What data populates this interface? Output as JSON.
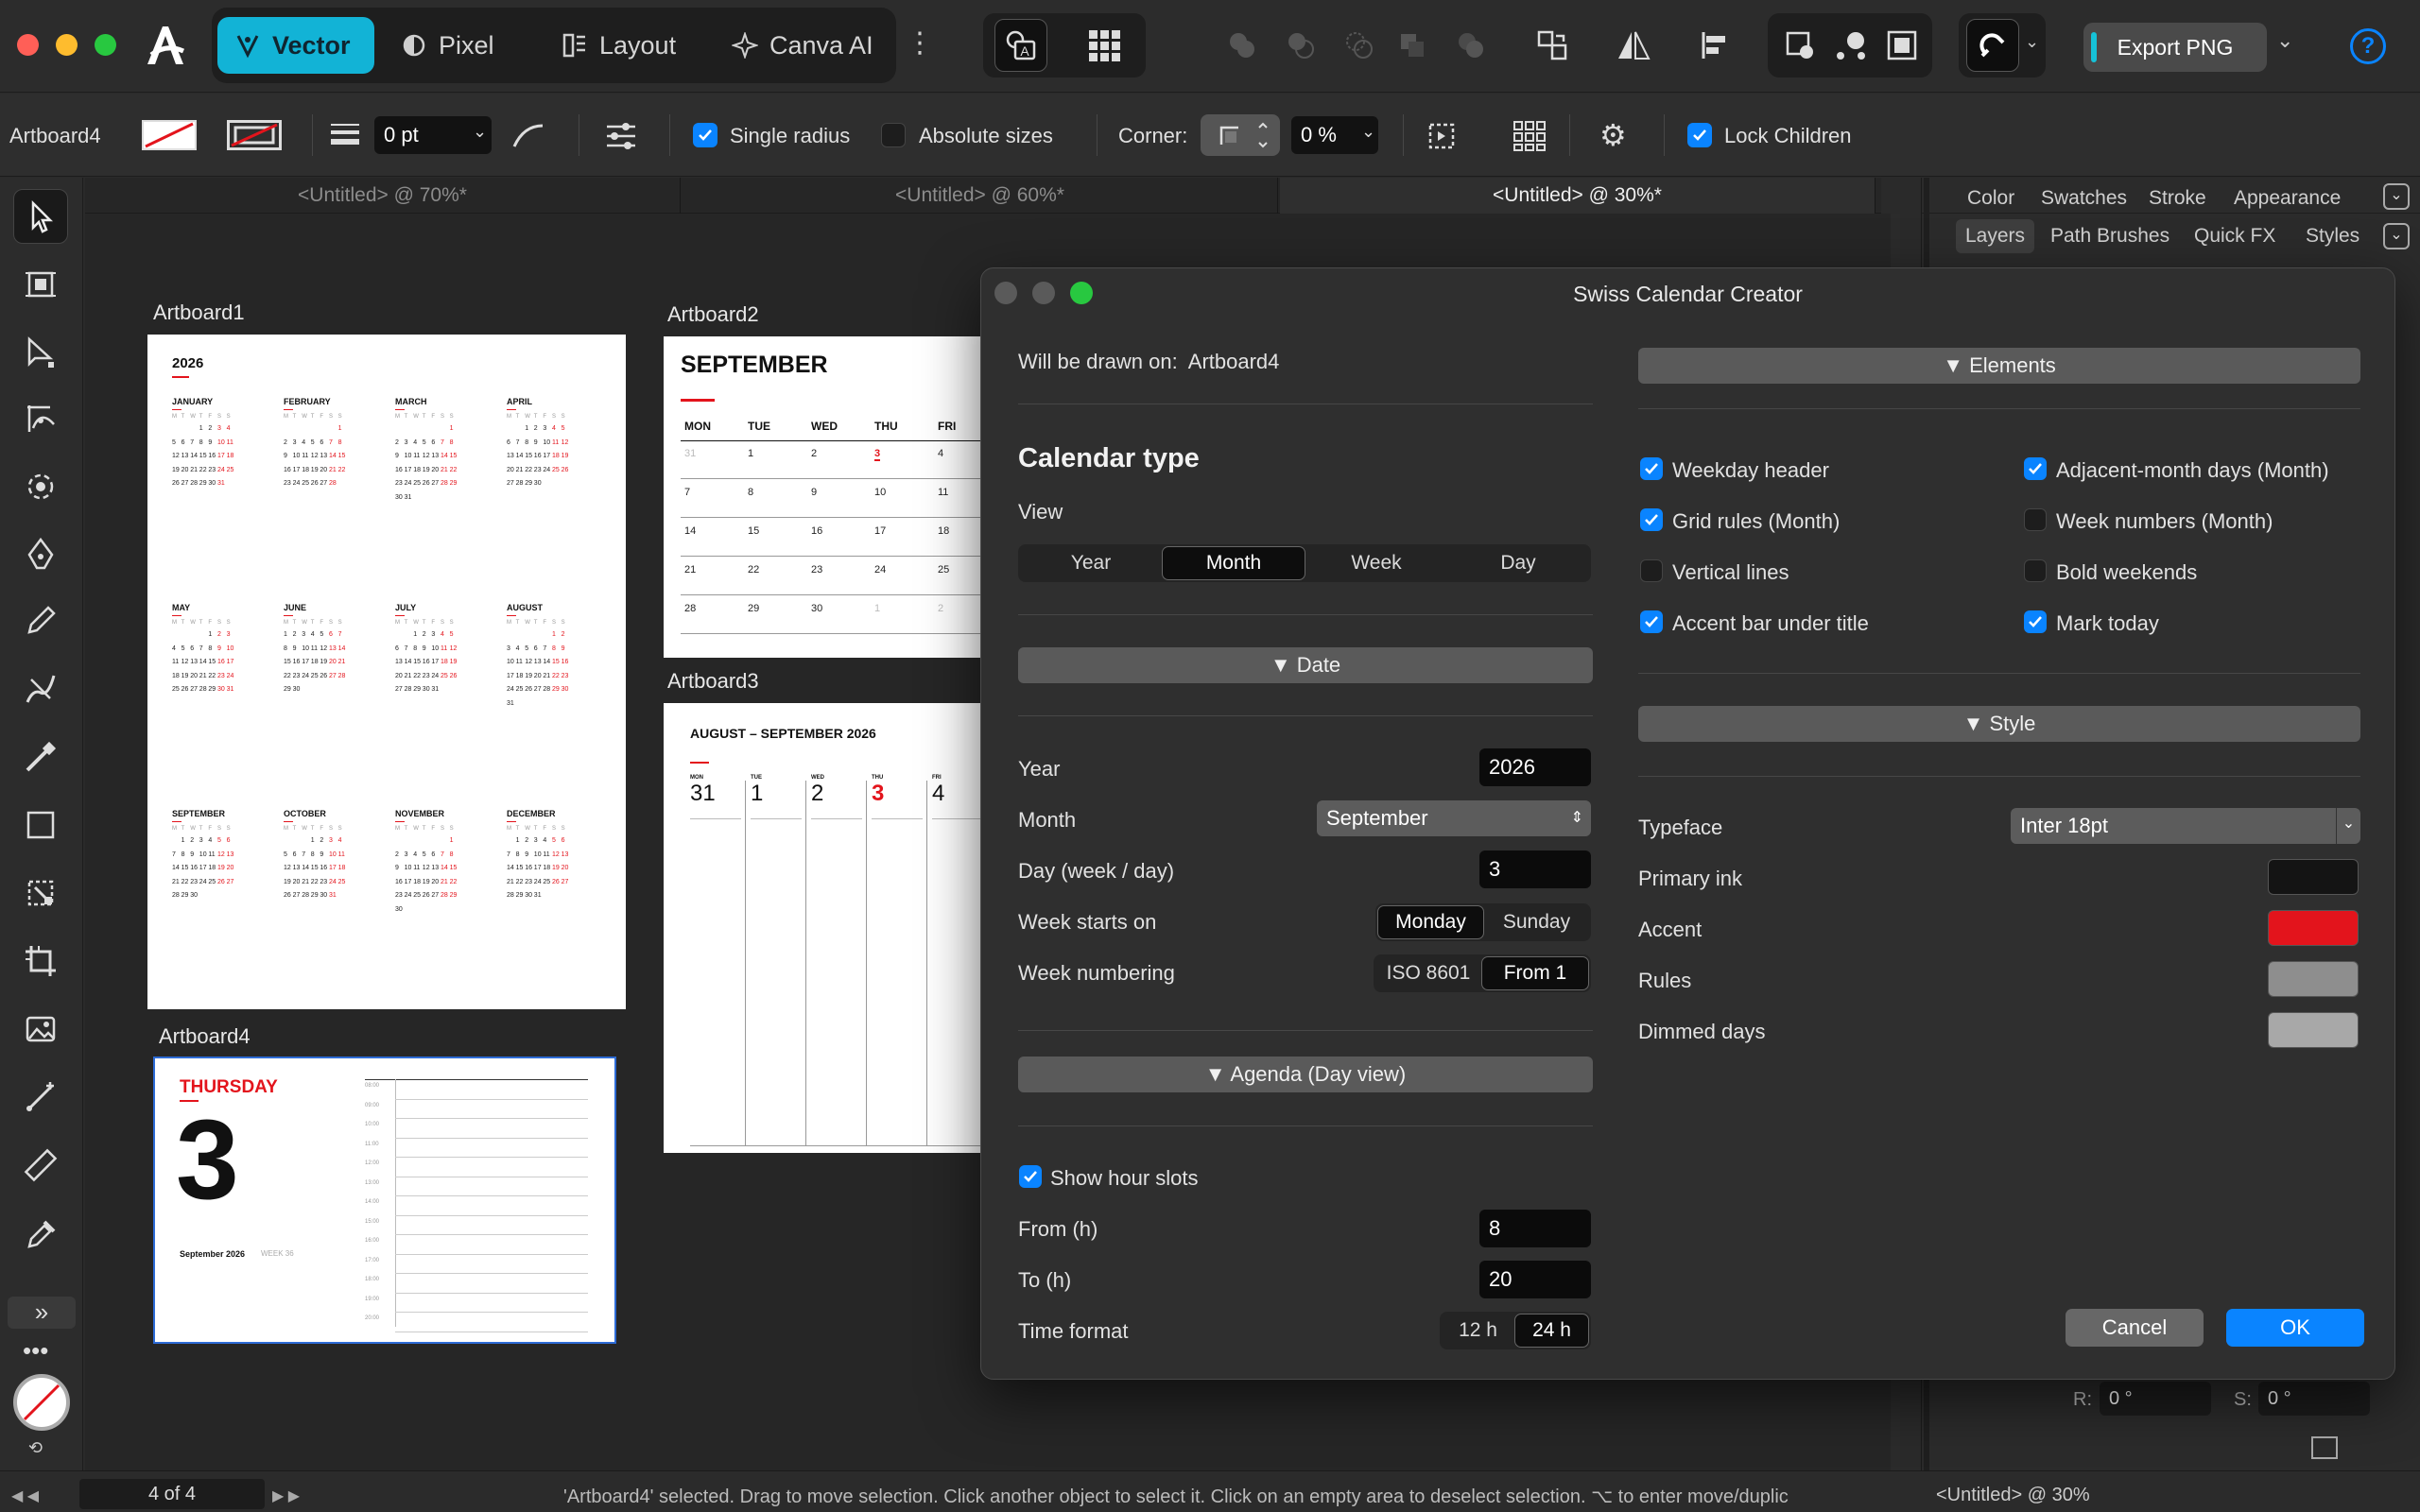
{
  "app": {
    "personas": [
      "Vector",
      "Pixel",
      "Layout",
      "Canva AI"
    ],
    "export_label": "Export PNG"
  },
  "context": {
    "object_name": "Artboard4",
    "stroke_width": "0 pt",
    "single_radius": "Single radius",
    "absolute_sizes": "Absolute sizes",
    "corner_label": "Corner:",
    "corner_value": "0 %",
    "lock_children": "Lock Children"
  },
  "tabs": [
    "<Untitled> @ 70%*",
    "<Untitled> @ 60%*",
    "<Untitled> @ 30%*"
  ],
  "panel": {
    "row1": [
      "Color",
      "Swatches",
      "Stroke",
      "Appearance"
    ],
    "row2": [
      "Layers",
      "Path Brushes",
      "Quick FX",
      "Styles"
    ],
    "r_label": "R:",
    "r_value": "0 °",
    "s_label": "S:",
    "s_value": "0 °"
  },
  "status": {
    "page": "4 of 4",
    "message": "'Artboard4' selected. Drag to move selection. Click another object to select it. Click on an empty area to deselect selection. ⌥ to enter move/duplic",
    "doc": "<Untitled> @ 30%"
  },
  "artboards": {
    "a1": {
      "label": "Artboard1",
      "year": "2026",
      "months": [
        "JANUARY",
        "FEBRUARY",
        "MARCH",
        "APRIL",
        "MAY",
        "JUNE",
        "JULY",
        "AUGUST",
        "SEPTEMBER",
        "OCTOBER",
        "NOVEMBER",
        "DECEMBER"
      ],
      "weekday_letters": "M T W T F S S"
    },
    "a2": {
      "label": "Artboard2",
      "title": "SEPTEMBER",
      "weekdays": [
        "MON",
        "TUE",
        "WED",
        "THU",
        "FRI"
      ],
      "rows": [
        [
          "31",
          "1",
          "2",
          "3",
          "4"
        ],
        [
          "7",
          "8",
          "9",
          "10",
          "11"
        ],
        [
          "14",
          "15",
          "16",
          "17",
          "18"
        ],
        [
          "21",
          "22",
          "23",
          "24",
          "25"
        ],
        [
          "28",
          "29",
          "30",
          "1",
          "2"
        ]
      ]
    },
    "a3": {
      "label": "Artboard3",
      "title": "AUGUST – SEPTEMBER 2026",
      "weekdays": [
        "MON",
        "TUE",
        "WED",
        "THU",
        "FRI"
      ],
      "days": [
        "31",
        "1",
        "2",
        "3",
        "4"
      ]
    },
    "a4": {
      "label": "Artboard4",
      "weekday": "THURSDAY",
      "day": "3",
      "month_year": "September 2026",
      "week": "WEEK 36",
      "hours": [
        "08:00",
        "09:00",
        "10:00",
        "11:00",
        "12:00",
        "13:00",
        "14:00",
        "15:00",
        "16:00",
        "17:00",
        "18:00",
        "19:00",
        "20:00"
      ]
    }
  },
  "dialog": {
    "title": "Swiss Calendar Creator",
    "drawn_on_label": "Will be drawn on:",
    "drawn_on_value": "Artboard4",
    "calendar_type": "Calendar type",
    "view_label": "View",
    "views": [
      "Year",
      "Month",
      "Week",
      "Day"
    ],
    "date_section": "▼ Date",
    "year_label": "Year",
    "year_value": "2026",
    "month_label": "Month",
    "month_value": "September",
    "day_label": "Day (week / day)",
    "day_value": "3",
    "week_starts_label": "Week starts on",
    "week_starts": [
      "Monday",
      "Sunday"
    ],
    "week_numbering_label": "Week numbering",
    "week_numbering": [
      "ISO 8601",
      "From 1"
    ],
    "agenda_section": "▼ Agenda (Day view)",
    "show_hour_slots": "Show hour slots",
    "from_label": "From (h)",
    "from_value": "8",
    "to_label": "To (h)",
    "to_value": "20",
    "time_format_label": "Time format",
    "time_formats": [
      "12 h",
      "24 h"
    ],
    "elements_section": "▼ Elements",
    "elements": [
      {
        "label": "Weekday header",
        "checked": true
      },
      {
        "label": "Adjacent-month days (Month)",
        "checked": true
      },
      {
        "label": "Grid rules (Month)",
        "checked": true
      },
      {
        "label": "Week numbers (Month)",
        "checked": false
      },
      {
        "label": "Vertical lines",
        "checked": false
      },
      {
        "label": "Bold weekends",
        "checked": false
      },
      {
        "label": "Accent bar under title",
        "checked": true
      },
      {
        "label": "Mark today",
        "checked": true
      }
    ],
    "style_section": "▼ Style",
    "typeface_label": "Typeface",
    "typeface_value": "Inter 18pt",
    "primary_ink_label": "Primary ink",
    "accent_label": "Accent",
    "rules_label": "Rules",
    "dimmed_label": "Dimmed days",
    "colors": {
      "primary_ink": "#141414",
      "accent": "#e3141c",
      "rules": "#8e8e8e",
      "dimmed": "#a8a8a8"
    },
    "cancel": "Cancel",
    "ok": "OK"
  }
}
